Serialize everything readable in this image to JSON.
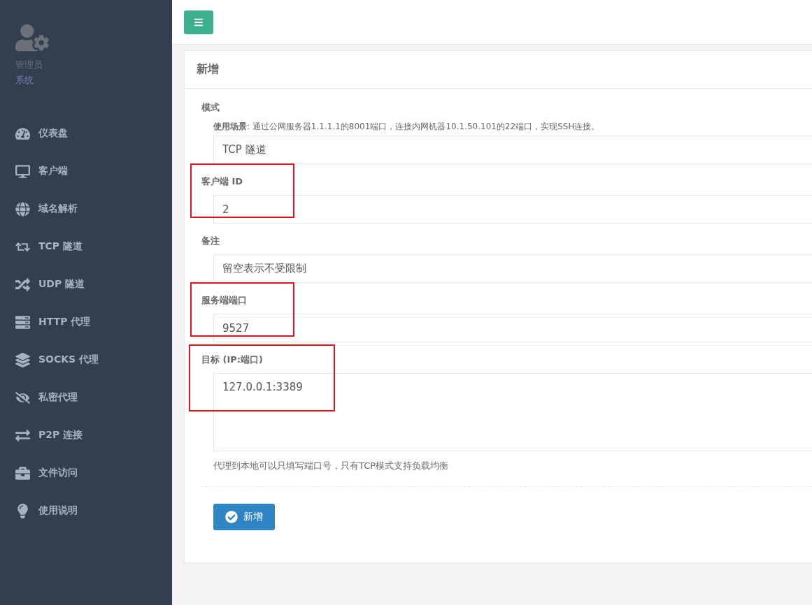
{
  "sidebar": {
    "user": {
      "name": "管理员",
      "role": "系统"
    },
    "items": [
      {
        "kind": "dashboard",
        "label": "仪表盘",
        "selected": false
      },
      {
        "kind": "client",
        "label": "客户端",
        "selected": false
      },
      {
        "kind": "domain",
        "label": "域名解析",
        "selected": false
      },
      {
        "kind": "tcp",
        "label": "TCP 隧道",
        "selected": false
      },
      {
        "kind": "udp",
        "label": "UDP 隧道",
        "selected": false
      },
      {
        "kind": "http",
        "label": "HTTP 代理",
        "selected": false
      },
      {
        "kind": "socks",
        "label": "SOCKS 代理",
        "selected": false
      },
      {
        "kind": "secret",
        "label": "私密代理",
        "selected": false
      },
      {
        "kind": "p2p",
        "label": "P2P 连接",
        "selected": false
      },
      {
        "kind": "file",
        "label": "文件访问",
        "selected": false
      },
      {
        "kind": "help",
        "label": "使用说明",
        "selected": false
      }
    ]
  },
  "panel": {
    "title": "新增",
    "fields": [
      {
        "kind": "select",
        "label": "模式",
        "note": "**使用场景**: 通过公网服务器1.1.1.1的8001端口，连接内网机器10.1.50.101的22端口，实现SSH连接。",
        "value": "TCP 隧道",
        "highlighted": false
      },
      {
        "kind": "input",
        "label": "客户端 ID",
        "value": "2",
        "highlighted": true
      },
      {
        "kind": "input",
        "label": "备注",
        "placeholder": "留空表示不受限制",
        "highlighted": false
      },
      {
        "kind": "input",
        "label": "服务端端口",
        "value": "9527",
        "highlighted": true
      },
      {
        "kind": "textarea",
        "label": "目标 (IP:端口)",
        "value": "127.0.0.1:3389",
        "help": "代理到本地可以只填写端口号，只有TCP模式支持负载均衡",
        "highlighted": true
      }
    ],
    "submit": "新增"
  }
}
